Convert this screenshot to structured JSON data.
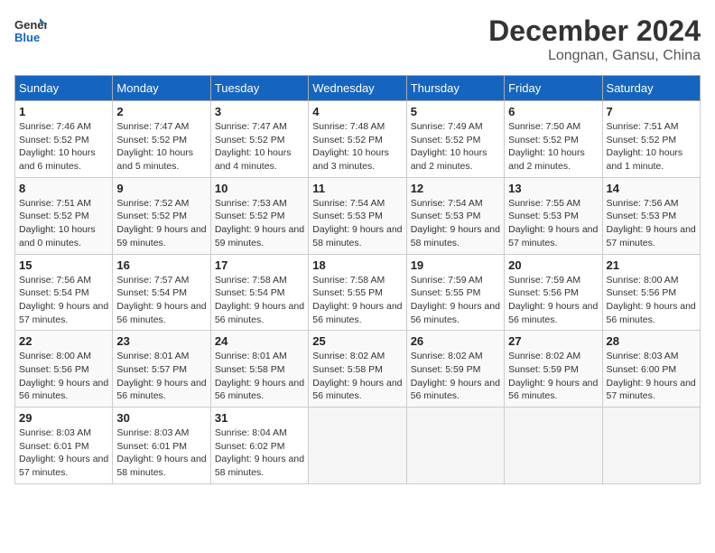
{
  "logo": {
    "line1": "General",
    "line2": "Blue"
  },
  "title": "December 2024",
  "location": "Longnan, Gansu, China",
  "days_of_week": [
    "Sunday",
    "Monday",
    "Tuesday",
    "Wednesday",
    "Thursday",
    "Friday",
    "Saturday"
  ],
  "weeks": [
    [
      {
        "day": "1",
        "sunrise": "Sunrise: 7:46 AM",
        "sunset": "Sunset: 5:52 PM",
        "daylight": "Daylight: 10 hours and 6 minutes."
      },
      {
        "day": "2",
        "sunrise": "Sunrise: 7:47 AM",
        "sunset": "Sunset: 5:52 PM",
        "daylight": "Daylight: 10 hours and 5 minutes."
      },
      {
        "day": "3",
        "sunrise": "Sunrise: 7:47 AM",
        "sunset": "Sunset: 5:52 PM",
        "daylight": "Daylight: 10 hours and 4 minutes."
      },
      {
        "day": "4",
        "sunrise": "Sunrise: 7:48 AM",
        "sunset": "Sunset: 5:52 PM",
        "daylight": "Daylight: 10 hours and 3 minutes."
      },
      {
        "day": "5",
        "sunrise": "Sunrise: 7:49 AM",
        "sunset": "Sunset: 5:52 PM",
        "daylight": "Daylight: 10 hours and 2 minutes."
      },
      {
        "day": "6",
        "sunrise": "Sunrise: 7:50 AM",
        "sunset": "Sunset: 5:52 PM",
        "daylight": "Daylight: 10 hours and 2 minutes."
      },
      {
        "day": "7",
        "sunrise": "Sunrise: 7:51 AM",
        "sunset": "Sunset: 5:52 PM",
        "daylight": "Daylight: 10 hours and 1 minute."
      }
    ],
    [
      {
        "day": "8",
        "sunrise": "Sunrise: 7:51 AM",
        "sunset": "Sunset: 5:52 PM",
        "daylight": "Daylight: 10 hours and 0 minutes."
      },
      {
        "day": "9",
        "sunrise": "Sunrise: 7:52 AM",
        "sunset": "Sunset: 5:52 PM",
        "daylight": "Daylight: 9 hours and 59 minutes."
      },
      {
        "day": "10",
        "sunrise": "Sunrise: 7:53 AM",
        "sunset": "Sunset: 5:52 PM",
        "daylight": "Daylight: 9 hours and 59 minutes."
      },
      {
        "day": "11",
        "sunrise": "Sunrise: 7:54 AM",
        "sunset": "Sunset: 5:53 PM",
        "daylight": "Daylight: 9 hours and 58 minutes."
      },
      {
        "day": "12",
        "sunrise": "Sunrise: 7:54 AM",
        "sunset": "Sunset: 5:53 PM",
        "daylight": "Daylight: 9 hours and 58 minutes."
      },
      {
        "day": "13",
        "sunrise": "Sunrise: 7:55 AM",
        "sunset": "Sunset: 5:53 PM",
        "daylight": "Daylight: 9 hours and 57 minutes."
      },
      {
        "day": "14",
        "sunrise": "Sunrise: 7:56 AM",
        "sunset": "Sunset: 5:53 PM",
        "daylight": "Daylight: 9 hours and 57 minutes."
      }
    ],
    [
      {
        "day": "15",
        "sunrise": "Sunrise: 7:56 AM",
        "sunset": "Sunset: 5:54 PM",
        "daylight": "Daylight: 9 hours and 57 minutes."
      },
      {
        "day": "16",
        "sunrise": "Sunrise: 7:57 AM",
        "sunset": "Sunset: 5:54 PM",
        "daylight": "Daylight: 9 hours and 56 minutes."
      },
      {
        "day": "17",
        "sunrise": "Sunrise: 7:58 AM",
        "sunset": "Sunset: 5:54 PM",
        "daylight": "Daylight: 9 hours and 56 minutes."
      },
      {
        "day": "18",
        "sunrise": "Sunrise: 7:58 AM",
        "sunset": "Sunset: 5:55 PM",
        "daylight": "Daylight: 9 hours and 56 minutes."
      },
      {
        "day": "19",
        "sunrise": "Sunrise: 7:59 AM",
        "sunset": "Sunset: 5:55 PM",
        "daylight": "Daylight: 9 hours and 56 minutes."
      },
      {
        "day": "20",
        "sunrise": "Sunrise: 7:59 AM",
        "sunset": "Sunset: 5:56 PM",
        "daylight": "Daylight: 9 hours and 56 minutes."
      },
      {
        "day": "21",
        "sunrise": "Sunrise: 8:00 AM",
        "sunset": "Sunset: 5:56 PM",
        "daylight": "Daylight: 9 hours and 56 minutes."
      }
    ],
    [
      {
        "day": "22",
        "sunrise": "Sunrise: 8:00 AM",
        "sunset": "Sunset: 5:56 PM",
        "daylight": "Daylight: 9 hours and 56 minutes."
      },
      {
        "day": "23",
        "sunrise": "Sunrise: 8:01 AM",
        "sunset": "Sunset: 5:57 PM",
        "daylight": "Daylight: 9 hours and 56 minutes."
      },
      {
        "day": "24",
        "sunrise": "Sunrise: 8:01 AM",
        "sunset": "Sunset: 5:58 PM",
        "daylight": "Daylight: 9 hours and 56 minutes."
      },
      {
        "day": "25",
        "sunrise": "Sunrise: 8:02 AM",
        "sunset": "Sunset: 5:58 PM",
        "daylight": "Daylight: 9 hours and 56 minutes."
      },
      {
        "day": "26",
        "sunrise": "Sunrise: 8:02 AM",
        "sunset": "Sunset: 5:59 PM",
        "daylight": "Daylight: 9 hours and 56 minutes."
      },
      {
        "day": "27",
        "sunrise": "Sunrise: 8:02 AM",
        "sunset": "Sunset: 5:59 PM",
        "daylight": "Daylight: 9 hours and 56 minutes."
      },
      {
        "day": "28",
        "sunrise": "Sunrise: 8:03 AM",
        "sunset": "Sunset: 6:00 PM",
        "daylight": "Daylight: 9 hours and 57 minutes."
      }
    ],
    [
      {
        "day": "29",
        "sunrise": "Sunrise: 8:03 AM",
        "sunset": "Sunset: 6:01 PM",
        "daylight": "Daylight: 9 hours and 57 minutes."
      },
      {
        "day": "30",
        "sunrise": "Sunrise: 8:03 AM",
        "sunset": "Sunset: 6:01 PM",
        "daylight": "Daylight: 9 hours and 58 minutes."
      },
      {
        "day": "31",
        "sunrise": "Sunrise: 8:04 AM",
        "sunset": "Sunset: 6:02 PM",
        "daylight": "Daylight: 9 hours and 58 minutes."
      },
      null,
      null,
      null,
      null
    ]
  ]
}
